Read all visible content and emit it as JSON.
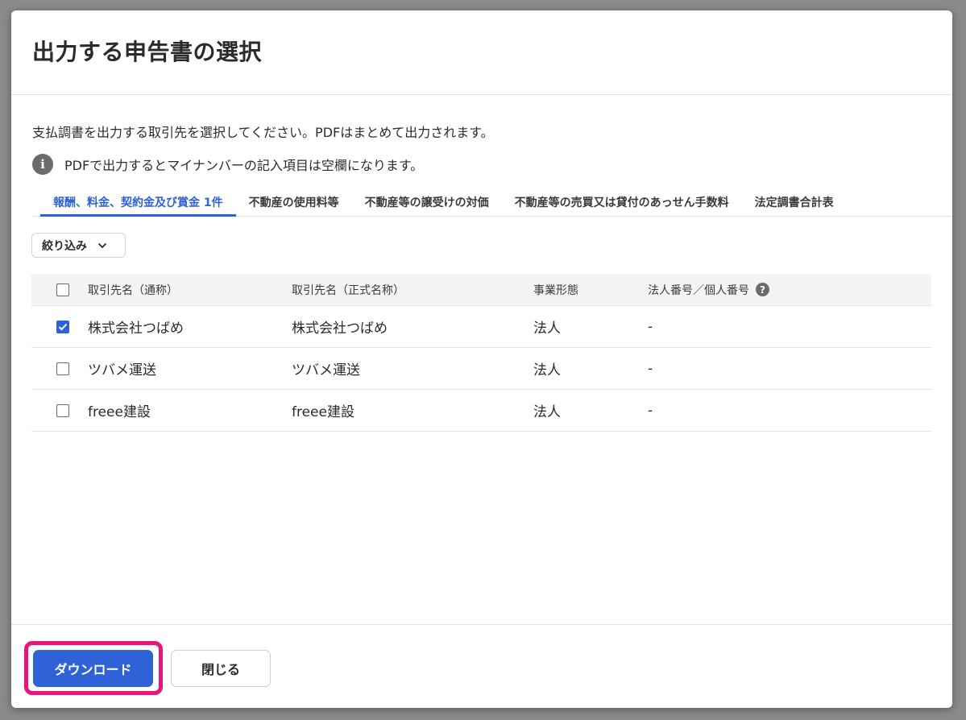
{
  "modal": {
    "title": "出力する申告書の選択",
    "description": "支払調書を出力する取引先を選択してください。PDFはまとめて出力されます。",
    "note": "PDFで出力するとマイナンバーの記入項目は空欄になります。",
    "info_icon": "i"
  },
  "tabs": [
    {
      "label": "報酬、料金、契約金及び賞金  1件",
      "active": true
    },
    {
      "label": "不動産の使用料等",
      "active": false
    },
    {
      "label": "不動産等の譲受けの対価",
      "active": false
    },
    {
      "label": "不動産等の売買又は貸付のあっせん手数料",
      "active": false
    },
    {
      "label": "法定調書合計表",
      "active": false
    }
  ],
  "filter": {
    "label": "絞り込み",
    "icon": "chevron-down-icon"
  },
  "table": {
    "headers": {
      "name": "取引先名（通称）",
      "formal_name": "取引先名（正式名称）",
      "type": "事業形態",
      "number": "法人番号／個人番号",
      "help": "?"
    },
    "rows": [
      {
        "checked": true,
        "name": "株式会社つばめ",
        "formal_name": "株式会社つばめ",
        "type": "法人",
        "number": "-"
      },
      {
        "checked": false,
        "name": "ツバメ運送",
        "formal_name": "ツバメ運送",
        "type": "法人",
        "number": "-"
      },
      {
        "checked": false,
        "name": "freee建設",
        "formal_name": "freee建設",
        "type": "法人",
        "number": "-"
      }
    ]
  },
  "footer": {
    "download_label": "ダウンロード",
    "close_label": "閉じる"
  },
  "colors": {
    "accent": "#2e62d6",
    "highlight": "#e8157a"
  }
}
